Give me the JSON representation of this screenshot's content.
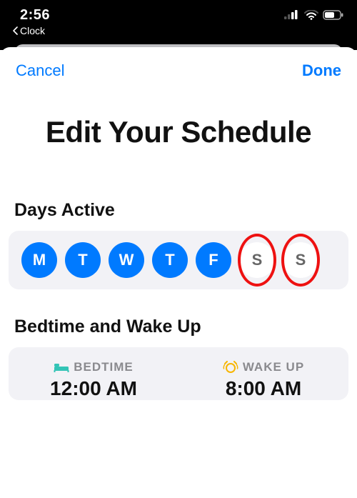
{
  "status": {
    "time": "2:56",
    "back_app": "Clock"
  },
  "nav": {
    "cancel": "Cancel",
    "done": "Done"
  },
  "title": "Edit Your Schedule",
  "days_section": {
    "header": "Days Active",
    "days": [
      {
        "label": "M",
        "active": true,
        "highlighted": false
      },
      {
        "label": "T",
        "active": true,
        "highlighted": false
      },
      {
        "label": "W",
        "active": true,
        "highlighted": false
      },
      {
        "label": "T",
        "active": true,
        "highlighted": false
      },
      {
        "label": "F",
        "active": true,
        "highlighted": false
      },
      {
        "label": "S",
        "active": false,
        "highlighted": true
      },
      {
        "label": "S",
        "active": false,
        "highlighted": true
      }
    ]
  },
  "bedtime_section": {
    "header": "Bedtime and Wake Up",
    "bedtime_label": "BEDTIME",
    "bedtime_value": "12:00 AM",
    "wake_label": "WAKE UP",
    "wake_value": "8:00 AM"
  }
}
